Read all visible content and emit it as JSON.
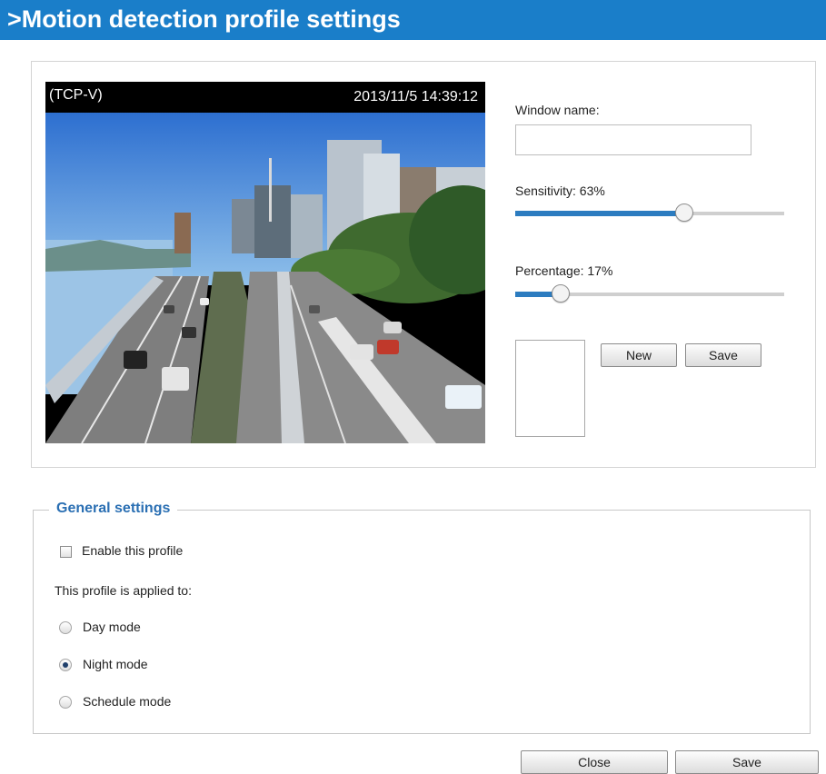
{
  "header": {
    "title": ">Motion detection profile settings"
  },
  "video": {
    "stream_label": "(TCP-V)",
    "timestamp": "2013/11/5 14:39:12"
  },
  "window": {
    "name_label": "Window name:",
    "name_value": "",
    "sensitivity_label": "Sensitivity: 63%",
    "sensitivity_value": 63,
    "percentage_label": "Percentage: 17%",
    "percentage_value": 17,
    "new_button": "New",
    "save_button": "Save"
  },
  "general": {
    "legend": "General settings",
    "enable_label": "Enable this profile",
    "enable_checked": false,
    "applied_to_label": "This profile is applied to:",
    "modes": [
      {
        "label": "Day mode",
        "checked": false
      },
      {
        "label": "Night mode",
        "checked": true
      },
      {
        "label": "Schedule mode",
        "checked": false
      }
    ]
  },
  "footer": {
    "close_button": "Close",
    "save_button": "Save"
  },
  "colors": {
    "header_bg": "#1a7ec9",
    "accent": "#2c7cc0",
    "legend": "#2a6fb3"
  }
}
